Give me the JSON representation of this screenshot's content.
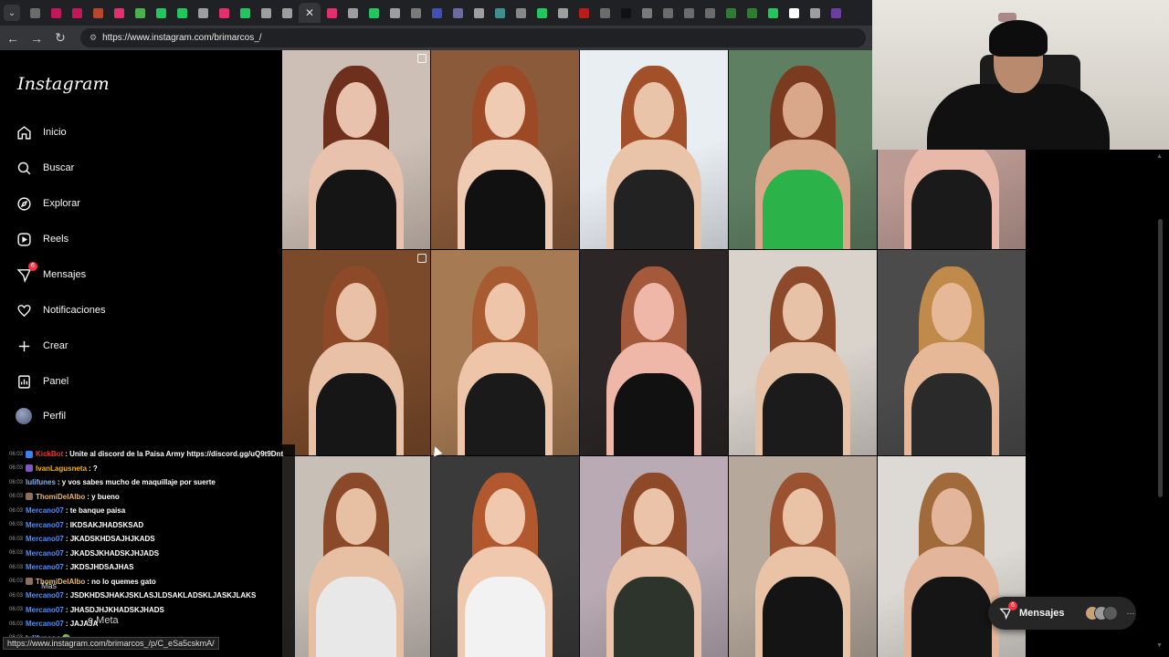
{
  "browser": {
    "url": "https://www.instagram.com/brimarcos_/",
    "tab_favicons": [
      "#6b6b6b",
      "#c2185b",
      "#c2185b",
      "#b7472a",
      "#e1306c",
      "#4caf50",
      "#23c55e",
      "#23c55e",
      "#9e9e9e",
      "#e1306c",
      "#23c55e",
      "#9e9e9e",
      "#9e9e9e",
      "#e1306c",
      "#9e9e9e",
      "#23c55e",
      "#9e9e9e",
      "#7a7a7a",
      "#3f51b5",
      "#6b6b9e",
      "#9e9e9e",
      "#3f8f8f",
      "#888888",
      "#23c55e",
      "#9e9e9e",
      "#b71c1c",
      "#6b6b6b",
      "#111111",
      "#7a7a7a",
      "#6b6b6b",
      "#6b6b6b",
      "#6b6b6b",
      "#2e7d32",
      "#2e7d32",
      "#23c55e",
      "#ffffff",
      "#9e9e9e",
      "#6b3fa0"
    ],
    "active_tab_icon": "close-icon",
    "status_url": "https://www.instagram.com/brimarcos_/p/C_eSa5cskmA/"
  },
  "instagram": {
    "logo": "Instagram",
    "nav": [
      {
        "label": "Inicio",
        "icon": "home-icon"
      },
      {
        "label": "Buscar",
        "icon": "search-icon"
      },
      {
        "label": "Explorar",
        "icon": "compass-icon"
      },
      {
        "label": "Reels",
        "icon": "reels-icon"
      },
      {
        "label": "Mensajes",
        "icon": "messenger-icon",
        "badge": "6"
      },
      {
        "label": "Notificaciones",
        "icon": "heart-icon"
      },
      {
        "label": "Crear",
        "icon": "plus-icon"
      },
      {
        "label": "Panel",
        "icon": "dashboard-icon"
      },
      {
        "label": "Perfil",
        "icon": "avatar"
      }
    ],
    "more_label": "Más",
    "meta_label": "e Meta",
    "messages_pill": {
      "label": "Mensajes",
      "badge": "6",
      "icon": "messenger-icon"
    }
  },
  "grid": {
    "photos": [
      {
        "bg": "#cdbfb5",
        "hair": "#6e2f1c",
        "skin": "#e8c2ad",
        "top": "#151515",
        "multi": true
      },
      {
        "bg": "#8a5a3a",
        "hair": "#9c4a26",
        "skin": "#efcbb3",
        "top": "#111111",
        "multi": false
      },
      {
        "bg": "#e9eef3",
        "hair": "#a2502a",
        "skin": "#e9c4a8",
        "top": "#222222",
        "multi": false
      },
      {
        "bg": "#5f7f63",
        "hair": "#7a3b21",
        "skin": "#d9a88a",
        "top": "#2bb34a",
        "multi": false
      },
      {
        "bg": "#bb9a93",
        "hair": "#6b3a2a",
        "skin": "#e8b9a8",
        "top": "#1a1a1a",
        "multi": false
      },
      {
        "bg": "#7a4a2a",
        "hair": "#8e4a28",
        "skin": "#e9c1a6",
        "top": "#161616",
        "multi": true
      },
      {
        "bg": "#a67a52",
        "hair": "#a85a30",
        "skin": "#efc5aa",
        "top": "#1a1a1a",
        "multi": false
      },
      {
        "bg": "#2c2626",
        "hair": "#a3593a",
        "skin": "#eeb7a8",
        "top": "#111111",
        "multi": false
      },
      {
        "bg": "#d9d3cc",
        "hair": "#8c4a2a",
        "skin": "#e8c2a6",
        "top": "#1b1b1b",
        "multi": false
      },
      {
        "bg": "#4b4b4b",
        "hair": "#c08a4a",
        "skin": "#e6b898",
        "top": "#2a2a2a",
        "multi": false
      },
      {
        "bg": "#c8bfb7",
        "hair": "#8a4a2a",
        "skin": "#e7c0a4",
        "top": "#e8e8e8",
        "multi": false
      },
      {
        "bg": "#3a3a3a",
        "hair": "#b2582f",
        "skin": "#efc8ae",
        "top": "#f2f2f2",
        "multi": false
      },
      {
        "bg": "#b9aab4",
        "hair": "#8e4a28",
        "skin": "#ebc3a9",
        "top": "#2d342c",
        "multi": false
      },
      {
        "bg": "#b6a99c",
        "hair": "#9a5230",
        "skin": "#eac2a6",
        "top": "#141414",
        "multi": false
      },
      {
        "bg": "#ddd9d4",
        "hair": "#a06a3a",
        "skin": "#e3b59a",
        "top": "#151515",
        "multi": false
      }
    ]
  },
  "chat": {
    "messages": [
      {
        "time": "06:03",
        "user": "KickBot",
        "user_color": "#e53935",
        "badge_color": "#3b82f6",
        "text": ": Unite al discord de la Paisa Army https://discord.gg/uQ9t9Dnt"
      },
      {
        "time": "06:03",
        "user": "IvanLagusneta",
        "user_color": "#f4b400",
        "badge_color": "#7e57c2",
        "text": ": ?"
      },
      {
        "time": "06:03",
        "user": "lulifunes",
        "user_color": "#8ab4f8",
        "badge_color": "",
        "text": ": y vos sabes mucho de maquillaje por suerte"
      },
      {
        "time": "06:03",
        "user": "ThomiDelAlbo",
        "user_color": "#e6b96b",
        "badge_color": "#8d6e63",
        "text": ": y bueno"
      },
      {
        "time": "06:03",
        "user": "Mercano07",
        "user_color": "#4f8fff",
        "badge_color": "",
        "text": ": te banque paisa"
      },
      {
        "time": "06:03",
        "user": "Mercano07",
        "user_color": "#4f8fff",
        "badge_color": "",
        "text": ": IKDSAKJHADSKSAD"
      },
      {
        "time": "06:03",
        "user": "Mercano07",
        "user_color": "#4f8fff",
        "badge_color": "",
        "text": ": JKADSKHDSAJHJKADS"
      },
      {
        "time": "06:03",
        "user": "Mercano07",
        "user_color": "#4f8fff",
        "badge_color": "",
        "text": ": JKADSJKHADSKJHJADS"
      },
      {
        "time": "06:03",
        "user": "Mercano07",
        "user_color": "#4f8fff",
        "badge_color": "",
        "text": ": JKDSJHDSAJHAS"
      },
      {
        "time": "06:03",
        "user": "ThomiDelAlbo",
        "user_color": "#e6b96b",
        "badge_color": "#8d6e63",
        "text": ": no lo quemes gato"
      },
      {
        "time": "06:03",
        "user": "Mercano07",
        "user_color": "#4f8fff",
        "badge_color": "",
        "text": ": JSDKHDSJHAKJSKLASJLDSAKLADSKLJASKJLAKS"
      },
      {
        "time": "06:03",
        "user": "Mercano07",
        "user_color": "#4f8fff",
        "badge_color": "",
        "text": ": JHASDJHJKHADSKJHADS"
      },
      {
        "time": "06:03",
        "user": "Mercano07",
        "user_color": "#4f8fff",
        "badge_color": "",
        "text": ": JAJAJA"
      },
      {
        "time": "06:03",
        "user": "lulifunes",
        "user_color": "#8ab4f8",
        "badge_color": "",
        "text": ": 🟢"
      }
    ]
  }
}
